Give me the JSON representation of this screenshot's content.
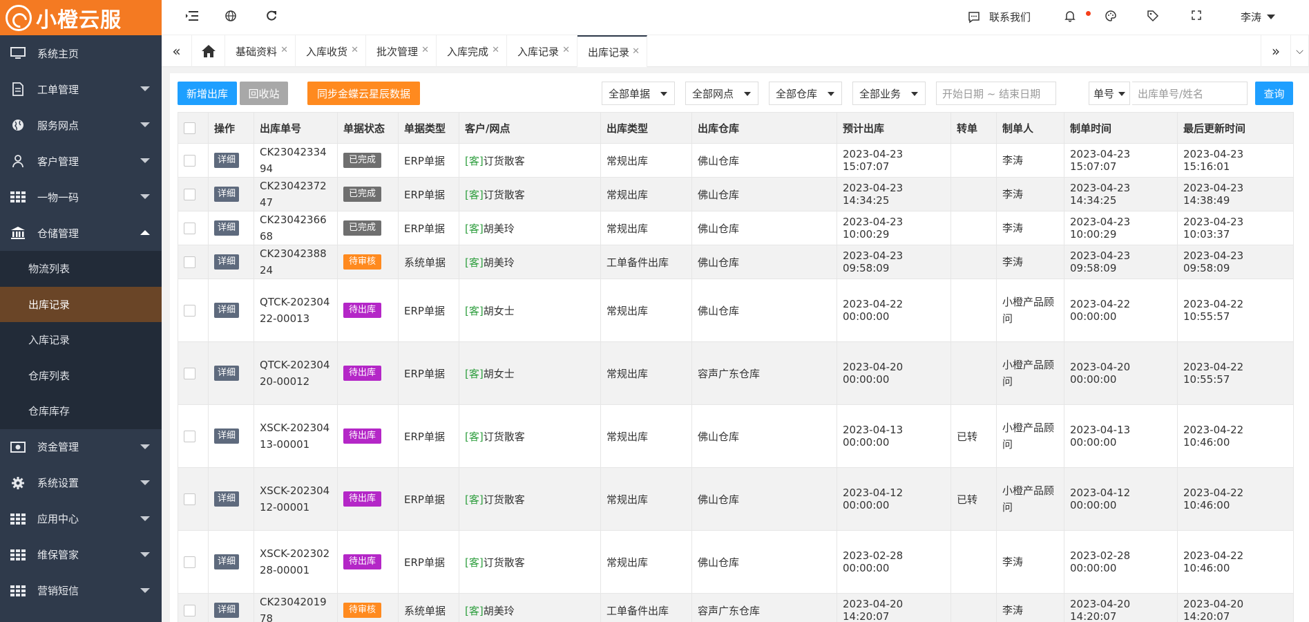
{
  "brand": {
    "name": "小橙云服"
  },
  "sidebar": {
    "items": [
      {
        "label": "系统主页",
        "icon": "monitor-icon",
        "arrow": ""
      },
      {
        "label": "工单管理",
        "icon": "document-icon",
        "arrow": "down"
      },
      {
        "label": "服务网点",
        "icon": "globe-icon",
        "arrow": "down"
      },
      {
        "label": "客户管理",
        "icon": "user-icon",
        "arrow": "down"
      },
      {
        "label": "一物一码",
        "icon": "grid-icon",
        "arrow": "down"
      },
      {
        "label": "仓储管理",
        "icon": "bank-icon",
        "arrow": "up"
      }
    ],
    "submenu": [
      {
        "label": "物流列表",
        "active": false
      },
      {
        "label": "出库记录",
        "active": true
      },
      {
        "label": "入库记录",
        "active": false
      },
      {
        "label": "仓库列表",
        "active": false
      },
      {
        "label": "仓库库存",
        "active": false
      }
    ],
    "items_after": [
      {
        "label": "资金管理",
        "icon": "money-icon",
        "arrow": "down"
      },
      {
        "label": "系统设置",
        "icon": "gear-icon",
        "arrow": "down"
      },
      {
        "label": "应用中心",
        "icon": "grid-icon",
        "arrow": "down"
      },
      {
        "label": "维保管家",
        "icon": "grid-icon",
        "arrow": "down"
      },
      {
        "label": "营销短信",
        "icon": "grid-icon",
        "arrow": "down"
      }
    ]
  },
  "header": {
    "contact_label": "联系我们",
    "user_name": "李涛"
  },
  "tabs": [
    {
      "label": "基础资料"
    },
    {
      "label": "入库收货"
    },
    {
      "label": "批次管理"
    },
    {
      "label": "入库完成"
    },
    {
      "label": "入库记录"
    },
    {
      "label": "出库记录"
    }
  ],
  "toolbar": {
    "add_label": "新增出库",
    "recycle_label": "回收站",
    "sync_label": "同步金蝶云星辰数据",
    "filter_doc": "全部单据",
    "filter_site": "全部网点",
    "filter_warehouse": "全部仓库",
    "filter_business": "全部业务",
    "date_placeholder": "开始日期 ~ 结束日期",
    "search_type": "单号",
    "search_placeholder": "出库单号/姓名",
    "query_label": "查询"
  },
  "colors": {
    "brand": "#f47a22",
    "primary": "#1e9fff",
    "sidebar": "#2f3a4b",
    "status_done": "#6f6f6f",
    "status_review": "#ff8a1f",
    "status_out": "#b427c7"
  },
  "table": {
    "columns": [
      "操作",
      "出库单号",
      "单据状态",
      "单据类型",
      "客户/网点",
      "出库类型",
      "出库仓库",
      "预计出库",
      "转单",
      "制单人",
      "制单时间",
      "最后更新时间"
    ],
    "detail_label": "详细",
    "cust_tag": "[客]",
    "rows": [
      {
        "no": "CK2304233494",
        "status": "已完成",
        "status_kind": "done",
        "doc_type": "ERP单据",
        "customer": "订货散客",
        "out_type": "常规出库",
        "warehouse": "佛山仓库",
        "expected": "2023-04-23 15:07:07",
        "transfer": "",
        "creator": "李涛",
        "created": "2023-04-23 15:07:07",
        "updated": "2023-04-23 15:16:01"
      },
      {
        "no": "CK2304237247",
        "status": "已完成",
        "status_kind": "done",
        "doc_type": "ERP单据",
        "customer": "订货散客",
        "out_type": "常规出库",
        "warehouse": "佛山仓库",
        "expected": "2023-04-23 14:34:25",
        "transfer": "",
        "creator": "李涛",
        "created": "2023-04-23 14:34:25",
        "updated": "2023-04-23 14:38:49"
      },
      {
        "no": "CK2304236668",
        "status": "已完成",
        "status_kind": "done",
        "doc_type": "ERP单据",
        "customer": "胡美玲",
        "out_type": "常规出库",
        "warehouse": "佛山仓库",
        "expected": "2023-04-23 10:00:29",
        "transfer": "",
        "creator": "李涛",
        "created": "2023-04-23 10:00:29",
        "updated": "2023-04-23 10:03:37"
      },
      {
        "no": "CK2304238824",
        "status": "待审核",
        "status_kind": "review",
        "doc_type": "系统单据",
        "customer": "胡美玲",
        "out_type": "工单备件出库",
        "warehouse": "佛山仓库",
        "expected": "2023-04-23 09:58:09",
        "transfer": "",
        "creator": "李涛",
        "created": "2023-04-23 09:58:09",
        "updated": "2023-04-23 09:58:09"
      },
      {
        "no": "QTCK-20230422-00013",
        "status": "待出库",
        "status_kind": "out",
        "doc_type": "ERP单据",
        "customer": "胡女士",
        "out_type": "常规出库",
        "warehouse": "佛山仓库",
        "expected": "2023-04-22 00:00:00",
        "transfer": "",
        "creator": "小橙产品顾问",
        "created": "2023-04-22 00:00:00",
        "updated": "2023-04-22 10:55:57"
      },
      {
        "no": "QTCK-20230420-00012",
        "status": "待出库",
        "status_kind": "out",
        "doc_type": "ERP单据",
        "customer": "胡女士",
        "out_type": "常规出库",
        "warehouse": "容声广东仓库",
        "expected": "2023-04-20 00:00:00",
        "transfer": "",
        "creator": "小橙产品顾问",
        "created": "2023-04-20 00:00:00",
        "updated": "2023-04-22 10:55:57"
      },
      {
        "no": "XSCK-20230413-00001",
        "status": "待出库",
        "status_kind": "out",
        "doc_type": "ERP单据",
        "customer": "订货散客",
        "out_type": "常规出库",
        "warehouse": "佛山仓库",
        "expected": "2023-04-13 00:00:00",
        "transfer": "已转",
        "creator": "小橙产品顾问",
        "created": "2023-04-13 00:00:00",
        "updated": "2023-04-22 10:46:00"
      },
      {
        "no": "XSCK-20230412-00001",
        "status": "待出库",
        "status_kind": "out",
        "doc_type": "ERP单据",
        "customer": "订货散客",
        "out_type": "常规出库",
        "warehouse": "佛山仓库",
        "expected": "2023-04-12 00:00:00",
        "transfer": "已转",
        "creator": "小橙产品顾问",
        "created": "2023-04-12 00:00:00",
        "updated": "2023-04-22 10:46:00"
      },
      {
        "no": "XSCK-20230228-00001",
        "status": "待出库",
        "status_kind": "out",
        "doc_type": "ERP单据",
        "customer": "订货散客",
        "out_type": "常规出库",
        "warehouse": "佛山仓库",
        "expected": "2023-02-28 00:00:00",
        "transfer": "",
        "creator": "李涛",
        "created": "2023-02-28 00:00:00",
        "updated": "2023-04-22 10:46:00"
      },
      {
        "no": "CK2304201978",
        "status": "待审核",
        "status_kind": "review",
        "doc_type": "系统单据",
        "customer": "胡美玲",
        "out_type": "工单备件出库",
        "warehouse": "容声广东仓库",
        "expected": "2023-04-20 14:20:07",
        "transfer": "",
        "creator": "李涛",
        "created": "2023-04-20 14:20:07",
        "updated": "2023-04-20 14:20:07"
      }
    ]
  }
}
